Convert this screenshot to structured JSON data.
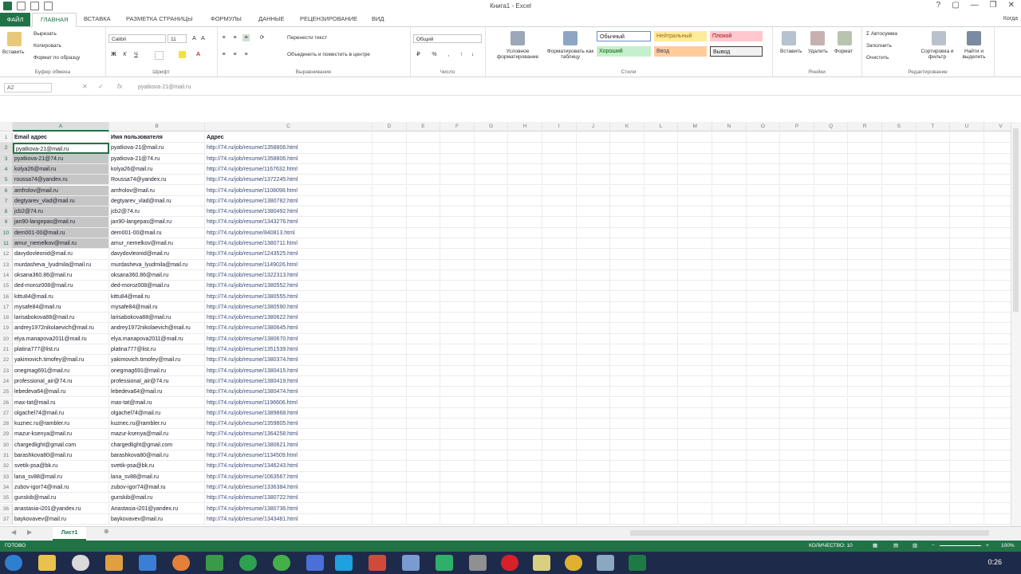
{
  "window": {
    "title": "Книга1 - Excel",
    "controls": [
      "?",
      "▢",
      "—",
      "❐",
      "✕"
    ],
    "user": "Когда"
  },
  "ribbon_tabs": [
    "ФАЙЛ",
    "ГЛАВНАЯ",
    "ВСТАВКА",
    "РАЗМЕТКА СТРАНИЦЫ",
    "ФОРМУЛЫ",
    "ДАННЫЕ",
    "РЕЦЕНЗИРОВАНИЕ",
    "ВИД"
  ],
  "ribbon": {
    "clipboard": {
      "paste": "Вставить",
      "cut": "Вырезать",
      "copy": "Копировать",
      "format_painter": "Формат по образцу",
      "label": "Буфер обмена"
    },
    "font": {
      "name": "Calibri",
      "size": "11",
      "label": "Шрифт"
    },
    "alignment": {
      "wrap": "Перенести текст",
      "merge": "Объединить и поместить в центре",
      "label": "Выравнивание"
    },
    "number": {
      "format": "Общий",
      "label": "Число"
    },
    "styles": {
      "conditional": "Условное форматирование",
      "as_table": "Форматировать как таблицу",
      "normal": "Обычный",
      "neutral": "Нейтральный",
      "bad": "Плохой",
      "good": "Хороший",
      "input": "Ввод",
      "output": "Вывод",
      "label": "Стили"
    },
    "cells": {
      "insert": "Вставить",
      "delete": "Удалить",
      "format": "Формат",
      "label": "Ячейки"
    },
    "editing": {
      "autosum": "Автосумма",
      "fill": "Заполнить",
      "clear": "Очистить",
      "sort": "Сортировка и фильтр",
      "find": "Найти и выделить",
      "label": "Редактирование"
    }
  },
  "formula_bar": {
    "namebox": "A2",
    "value": "pyatkova-21@mail.ru"
  },
  "columns": [
    "A",
    "B",
    "C",
    "D",
    "E",
    "F",
    "G",
    "H",
    "I",
    "J",
    "K",
    "L",
    "M",
    "N",
    "O",
    "P",
    "Q",
    "R",
    "S",
    "T",
    "U",
    "V"
  ],
  "sheet": {
    "headers": [
      "Email адрес",
      "Имя пользователя",
      "Адрес"
    ],
    "rows": [
      [
        "pyatkova-21@mail.ru",
        "pyatkova-21@mail.ru",
        "http://74.ru/job/resume/1358806.html"
      ],
      [
        "pyatkova-21@74.ru",
        "pyatkova-21@74.ru",
        "http://74.ru/job/resume/1358806.html"
      ],
      [
        "kolya26@mail.ru",
        "kolya26@mail.ru",
        "http://74.ru/job/resume/1167632.html"
      ],
      [
        "roussa74@yandex.ru",
        "Roussa74@yandex.ru",
        "http://74.ru/job/resume/1372245.html"
      ],
      [
        "amfrolov@mail.ru",
        "amfrolov@mail.ru",
        "http://74.ru/job/resume/1108098.html"
      ],
      [
        "degtyarev_vlad@mail.ru",
        "degtyarev_vlad@mail.ru",
        "http://74.ru/job/resume/1380782.html"
      ],
      [
        "jcb2@74.ru",
        "jcb2@74.ru",
        "http://74.ru/job/resume/1380492.html"
      ],
      [
        "jan90-langepas@mail.ru",
        "jan90-langepas@mail.ru",
        "http://74.ru/job/resume/1343276.html"
      ],
      [
        "dem001-00@mail.ru",
        "dem001-00@mail.ru",
        "http://74.ru/job/resume/840813.html"
      ],
      [
        "amur_nemelkov@mail.ru",
        "amur_nemelkov@mail.ru",
        "http://74.ru/job/resume/1380711.html"
      ],
      [
        "davydovleonid@mail.ru",
        "davydovleonid@mail.ru",
        "http://74.ru/job/resume/1243525.html"
      ],
      [
        "murdasheva_lyudmila@mail.ru",
        "murdasheva_lyudmila@mail.ru",
        "http://74.ru/job/resume/1149026.html"
      ],
      [
        "oksana360.86@mail.ru",
        "oksana360.86@mail.ru",
        "http://74.ru/job/resume/1322313.html"
      ],
      [
        "ded-moroz008@mail.ru",
        "ded-moroz008@mail.ru",
        "http://74.ru/job/resume/1380552.html"
      ],
      [
        "kittu84@mail.ru",
        "kittu84@mail.ru",
        "http://74.ru/job/resume/1380555.html"
      ],
      [
        "mysafe84@mail.ru",
        "mysafe84@mail.ru",
        "http://74.ru/job/resume/1380590.html"
      ],
      [
        "larisabokova88@mail.ru",
        "larisabokova88@mail.ru",
        "http://74.ru/job/resume/1380622.html"
      ],
      [
        "andrey1972nikolaevich@mail.ru",
        "andrey1972nikolaevich@mail.ru",
        "http://74.ru/job/resume/1380645.html"
      ],
      [
        "elya.manapova2011@mail.ru",
        "elya.manapova2011@mail.ru",
        "http://74.ru/job/resume/1380670.html"
      ],
      [
        "platina777@list.ru",
        "platina777@list.ru",
        "http://74.ru/job/resume/1351539.html"
      ],
      [
        "yakimovich.timofey@mail.ru",
        "yakimovich.timofey@mail.ru",
        "http://74.ru/job/resume/1380374.html"
      ],
      [
        "onegmag691@mail.ru",
        "onegmag691@mail.ru",
        "http://74.ru/job/resume/1380415.html"
      ],
      [
        "professional_air@74.ru",
        "professional_air@74.ru",
        "http://74.ru/job/resume/1380419.html"
      ],
      [
        "lebedeva64@mail.ru",
        "lebedeva64@mail.ru",
        "http://74.ru/job/resume/1380474.html"
      ],
      [
        "max-tat@mail.ru",
        "max-tat@mail.ru",
        "http://74.ru/job/resume/1196606.html"
      ],
      [
        "olgachel74@mail.ru",
        "olgachel74@mail.ru",
        "http://74.ru/job/resume/1389868.html"
      ],
      [
        "kuznec.ru@rambler.ru",
        "kuznec.ru@rambler.ru",
        "http://74.ru/job/resume/1359805.html"
      ],
      [
        "mazur-ksenya@mail.ru",
        "mazur-ksenya@mail.ru",
        "http://74.ru/job/resume/1364258.html"
      ],
      [
        "chargedlight@gmail.com",
        "chargedlight@gmail.com",
        "http://74.ru/job/resume/1380621.html"
      ],
      [
        "barashkova80@mail.ru",
        "barashkova80@mail.ru",
        "http://74.ru/job/resume/1134509.html"
      ],
      [
        "svetik-psa@bk.ru",
        "svetik-psa@bk.ru",
        "http://74.ru/job/resume/1346243.html"
      ],
      [
        "lana_sv88@mail.ru",
        "lana_sv88@mail.ru",
        "http://74.ru/job/resume/1063567.html"
      ],
      [
        "zubov-igor74@mail.ru",
        "zubov-igor74@mail.ru",
        "http://74.ru/job/resume/1336384.html"
      ],
      [
        "gunskib@mail.ru",
        "gunskib@mail.ru",
        "http://74.ru/job/resume/1380722.html"
      ],
      [
        "anastasia-i201@yandex.ru",
        "Anastasia-i201@yandex.ru",
        "http://74.ru/job/resume/1380736.html"
      ],
      [
        "baykovavev@mail.ru",
        "baykovavev@mail.ru",
        "http://74.ru/job/resume/1343481.html"
      ]
    ]
  },
  "sheet_tab": "Лист1",
  "status": {
    "ready": "ГОТОВО",
    "count": "КОЛИЧЕСТВО: 10",
    "zoom": "100%"
  },
  "clock": "0:26"
}
